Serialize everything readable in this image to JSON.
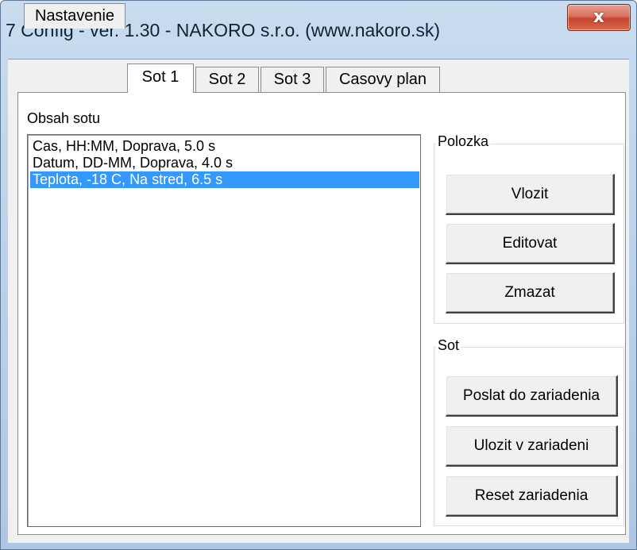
{
  "window": {
    "title": "7 Config - ver. 1.30 - NAKORO s.r.o. (www.nakoro.sk)",
    "close_glyph": "x"
  },
  "tabs": [
    {
      "label": "Nastavenie"
    },
    {
      "label": "Sot 1"
    },
    {
      "label": "Sot 2"
    },
    {
      "label": "Sot 3"
    },
    {
      "label": "Casovy plan"
    }
  ],
  "content": {
    "list_label": "Obsah sotu",
    "list_items": [
      {
        "text": "Cas, HH:MM, Doprava,  5.0 s"
      },
      {
        "text": "Datum, DD-MM, Doprava,  4.0 s"
      },
      {
        "text": "Teplota, -18  C, Na stred,  6.5 s"
      }
    ],
    "selected_index": 2
  },
  "polozka": {
    "title": "Polozka",
    "insert_label": "Vlozit",
    "edit_label": "Editovat",
    "delete_label": "Zmazat"
  },
  "sot": {
    "title": "Sot",
    "send_label": "Poslat do zariadenia",
    "save_label": "Ulozit v zariadeni",
    "reset_label": "Reset zariadenia"
  },
  "colors": {
    "selection": "#3399ff",
    "close_button": "#c4452c"
  }
}
